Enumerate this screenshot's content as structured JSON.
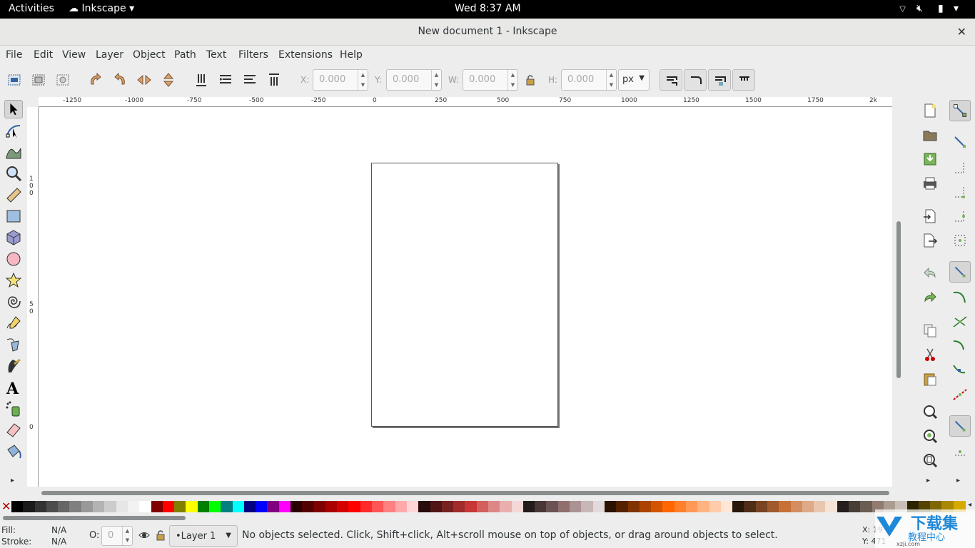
{
  "system_bar": {
    "activities": "Activities",
    "app_menu": "Inkscape",
    "clock": "Wed  8:37 AM"
  },
  "window": {
    "title": "New document 1 - Inkscape",
    "close": "✕"
  },
  "menu": [
    "File",
    "Edit",
    "View",
    "Layer",
    "Object",
    "Path",
    "Text",
    "Filters",
    "Extensions",
    "Help"
  ],
  "controls": {
    "x_label": "X:",
    "x_value": "0.000",
    "y_label": "Y:",
    "y_value": "0.000",
    "w_label": "W:",
    "w_value": "0.000",
    "h_label": "H:",
    "h_value": "0.000",
    "unit": "px"
  },
  "ruler": {
    "h_ticks": [
      "-1250",
      "-1000",
      "-750",
      "-500",
      "-250",
      "0",
      "250",
      "500",
      "750",
      "1000",
      "1250",
      "1500",
      "1750",
      "2k"
    ],
    "v_ticks": [
      "1",
      "0",
      "0",
      "5",
      "0",
      "0"
    ]
  },
  "toolbox_more": "▸",
  "palette": {
    "none": "✕",
    "colors": [
      "#000000",
      "#1a1a1a",
      "#333333",
      "#4d4d4d",
      "#666666",
      "#808080",
      "#999999",
      "#b3b3b3",
      "#cccccc",
      "#e6e6e6",
      "#f2f2f2",
      "#ffffff",
      "#800000",
      "#ff0000",
      "#808000",
      "#ffff00",
      "#008000",
      "#00ff00",
      "#008080",
      "#00ffff",
      "#000080",
      "#0000ff",
      "#800080",
      "#ff00ff",
      "#2b0000",
      "#550000",
      "#800000",
      "#aa0000",
      "#d40000",
      "#ff0000",
      "#ff2a2a",
      "#ff5555",
      "#ff8080",
      "#ffaaaa",
      "#ffd5d5",
      "#280b0b",
      "#501616",
      "#782121",
      "#a02c2c",
      "#c83737",
      "#d35f5f",
      "#de8787",
      "#e9afaf",
      "#f4d7d7",
      "#241c1c",
      "#483737",
      "#6c5353",
      "#916f6f",
      "#ac9393",
      "#c8b7b7",
      "#e3dbdb",
      "#2b1100",
      "#552200",
      "#803300",
      "#aa4400",
      "#d45500",
      "#ff6600",
      "#ff7f2a",
      "#ff9955",
      "#ffb380",
      "#ffccaa",
      "#ffe6d5",
      "#28170b",
      "#502d16",
      "#784421",
      "#a05a2c",
      "#c87137",
      "#d38d5f",
      "#deaa87",
      "#e9c6af",
      "#f4e3d7",
      "#241f1c",
      "#483e37",
      "#6c5d53",
      "#917c6f",
      "#ac9d93",
      "#c8beb7",
      "#2b2200",
      "#554400",
      "#806600",
      "#aa8800",
      "#d4aa00"
    ]
  },
  "status": {
    "fill_label": "Fill:",
    "fill_value": "N/A",
    "stroke_label": "Stroke:",
    "stroke_value": "N/A",
    "opacity_label": "O:",
    "opacity_value": "0",
    "layer": "•Layer 1",
    "message": "No objects selected. Click, Shift+click, Alt+scroll mouse on top of objects, or drag around objects to select.",
    "x_coord": "X: 19",
    "y_coord": "Y: 471"
  },
  "watermark": {
    "title": "下载集",
    "subtitle": "教程中心",
    "url": "xzji.com"
  }
}
